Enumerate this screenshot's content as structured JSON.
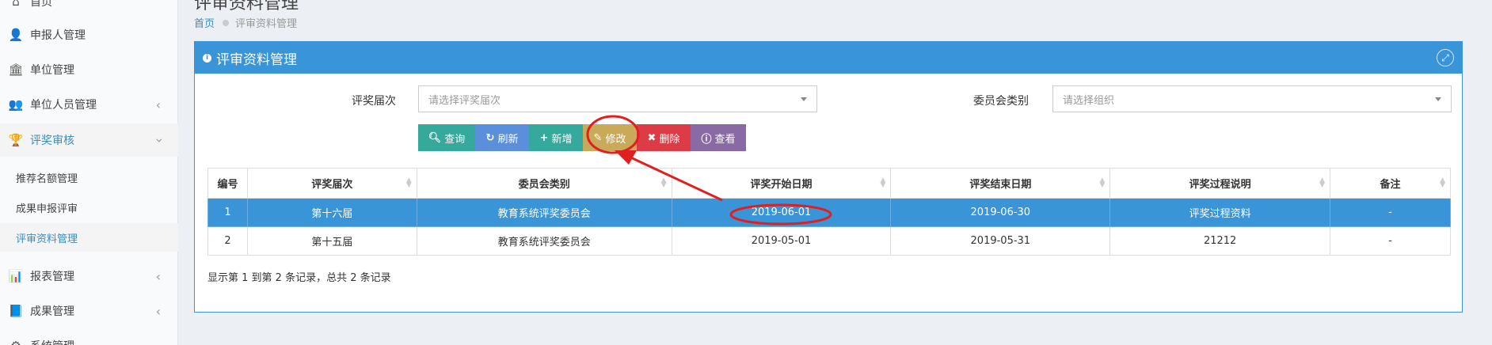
{
  "sidebar": {
    "items": [
      {
        "label": "首页",
        "icon": "home-icon"
      },
      {
        "label": "申报人管理",
        "icon": "user-icon"
      },
      {
        "label": "单位管理",
        "icon": "bank-icon"
      },
      {
        "label": "单位人员管理",
        "icon": "users-icon"
      },
      {
        "label": "评奖审核",
        "icon": "trophy-icon"
      },
      {
        "label": "报表管理",
        "icon": "bar-chart-icon"
      },
      {
        "label": "成果管理",
        "icon": "book-icon"
      },
      {
        "label": "系统管理",
        "icon": "gear-icon"
      }
    ],
    "sub_items": [
      {
        "label": "推荐名额管理"
      },
      {
        "label": "成果申报评审"
      },
      {
        "label": "评审资料管理"
      }
    ]
  },
  "header": {
    "title": "评审资料管理",
    "breadcrumb_home": "首页",
    "breadcrumb_current": "评审资料管理"
  },
  "panel": {
    "title": "评审资料管理",
    "filters": {
      "session_label": "评奖届次",
      "session_placeholder": "请选择评奖届次",
      "committee_label": "委员会类别",
      "committee_placeholder": "请选择组织"
    },
    "buttons": {
      "query": "查询",
      "refresh": "刷新",
      "add": "新增",
      "edit": "修改",
      "delete": "删除",
      "view": "查看"
    },
    "table": {
      "headers": [
        "编号",
        "评奖届次",
        "委员会类别",
        "评奖开始日期",
        "评奖结束日期",
        "评奖过程说明",
        "备注"
      ],
      "rows": [
        [
          "1",
          "第十六届",
          "教育系统评奖委员会",
          "2019-06-01",
          "2019-06-30",
          "评奖过程资料",
          "-"
        ],
        [
          "2",
          "第十五届",
          "教育系统评奖委员会",
          "2019-05-01",
          "2019-05-31",
          "21212",
          "-"
        ]
      ]
    },
    "pager_text": "显示第 1 到第 2 条记录，总共 2 条记录"
  },
  "colors": {
    "primary": "#3a94d8",
    "query_btn": "#35a99c",
    "refresh_btn": "#5b8fdb",
    "add_btn": "#35a99c",
    "edit_btn": "#c9a95a",
    "delete_btn": "#dd3b45",
    "view_btn": "#8a6aa5",
    "annotation": "#e02020"
  }
}
